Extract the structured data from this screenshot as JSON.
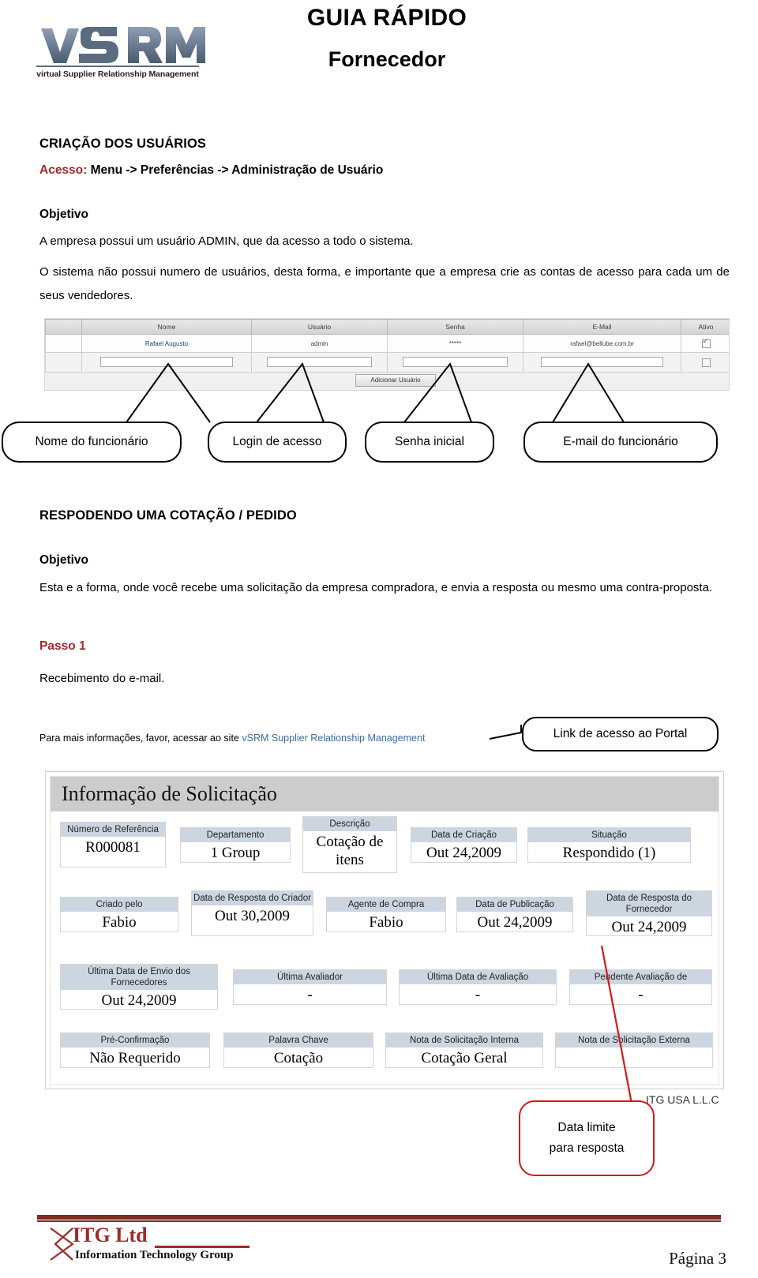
{
  "header": {
    "logo_text": "vSRM",
    "logo_tagline": "virtual Supplier Relationship Management",
    "title": "GUIA RÁPIDO",
    "subtitle": "Fornecedor"
  },
  "section1": {
    "heading": "CRIAÇÃO DOS USUÁRIOS",
    "access_label": "Acesso:",
    "access_path": "Menu -> Preferências -> Administração de Usuário",
    "objective_label": "Objetivo",
    "paragraph1": "A empresa possui um usuário ADMIN, que da acesso a todo o sistema.",
    "paragraph2": "O sistema não possui numero de usuários, desta forma, e importante que a empresa crie as contas de acesso para cada um de seus vendedores."
  },
  "user_table": {
    "columns": [
      "Nome",
      "Usuário",
      "Senha",
      "E-Mail",
      "Ativo"
    ],
    "rows": [
      {
        "nome": "Rafael Augusto",
        "usuario": "admin",
        "senha": "*****",
        "email": "rafael@bellube.com.br",
        "ativo": true
      }
    ],
    "add_button": "Adicionar Usuário"
  },
  "table_callouts": [
    {
      "label": "Nome do funcionário"
    },
    {
      "label": "Login de acesso"
    },
    {
      "label": "Senha inicial"
    },
    {
      "label": "E-mail  do funcionário"
    }
  ],
  "section2": {
    "heading": "RESPODENDO UMA COTAÇÃO / PEDIDO",
    "objective_label": "Objetivo",
    "paragraph1": "Esta e a forma, onde você recebe uma solicitação da empresa compradora, e envia a resposta ou mesmo uma contra-proposta.",
    "step_label": "Passo 1",
    "step_text": "Recebimento do e-mail."
  },
  "email_line": {
    "prefix": "Para mais informações, favor, acessar ao site ",
    "link": "vSRM Supplier Relationship Management",
    "callout": "Link de acesso ao Portal"
  },
  "form": {
    "title": "Informação de Solicitação",
    "rows": [
      [
        {
          "label": "Número de Referência",
          "value": "R000081"
        },
        {
          "label": "Departamento",
          "value": "1 Group"
        },
        {
          "label": "Descrição",
          "value": "Cotação de itens"
        },
        {
          "label": "Data de Criação",
          "value": "Out 24,2009"
        },
        {
          "label": "Situação",
          "value": "Respondido (1)"
        }
      ],
      [
        {
          "label": "Criado pelo",
          "value": "Fabio"
        },
        {
          "label": "Data de Resposta do Criador",
          "value": "Out 30,2009"
        },
        {
          "label": "Agente de Compra",
          "value": "Fabio"
        },
        {
          "label": "Data de Publicação",
          "value": "Out 24,2009"
        },
        {
          "label": "Data de Resposta do Fornecedor",
          "value": "Out 24,2009"
        }
      ],
      [
        {
          "label": "Última Data de Envio dos Fornecedores",
          "value": "Out 24,2009"
        },
        {
          "label": "Última Avaliador",
          "value": "-"
        },
        {
          "label": "Última Data de Avaliação",
          "value": "-"
        },
        {
          "label": "Pendente Avaliação de",
          "value": "-"
        }
      ],
      [
        {
          "label": "Pré-Confirmação",
          "value": "Não Requerido"
        },
        {
          "label": "Palavra Chave",
          "value": "Cotação"
        },
        {
          "label": "Nota de Solicitação Interna",
          "value": "Cotação Geral"
        },
        {
          "label": "Nota de Solicitação Externa",
          "value": ""
        }
      ]
    ],
    "watermark": "ITG USA L.L.C",
    "deadline_callout_line1": "Data limite",
    "deadline_callout_line2": "para resposta"
  },
  "footer": {
    "company": "ITG Ltd",
    "company_sub": "Information Technology Group",
    "page": "Página 3"
  },
  "colors": {
    "accent_red": "#9e2a2b",
    "callout_red": "#d01a1a",
    "panel_header": "#cccccc",
    "field_label_bg": "#ccd6e0",
    "link_blue": "#3a6ea5"
  }
}
